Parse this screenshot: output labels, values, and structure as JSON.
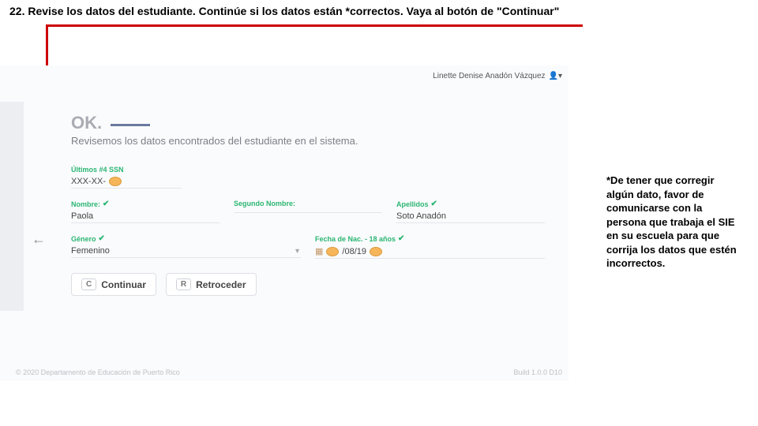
{
  "instruction": "22.  Revise los datos del estudiante.  Continúe si los datos están *correctos.  Vaya al botón de \"Continuar\"",
  "note": "*De tener que corregir algún dato, favor de comunicarse con la persona que trabaja el SIE en su escuela para que corrija los datos que estén incorrectos.",
  "user": {
    "name": "Linette Denise Anadón Vázquez"
  },
  "heading": {
    "ok": "OK.",
    "sub": "Revisemos los datos encontrados del estudiante en el sistema."
  },
  "fields": {
    "ssn": {
      "label": "Últimos #4 SSN",
      "value": "XXX-XX-"
    },
    "name": {
      "label": "Nombre:",
      "value": "Paola"
    },
    "second": {
      "label": "Segundo Nombre:",
      "value": ""
    },
    "last": {
      "label": "Apellidos",
      "value": "Soto Anadón"
    },
    "gender": {
      "label": "Género",
      "value": "Femenino"
    },
    "dob": {
      "label": "Fecha de Nac. - 18 años",
      "value": "/08/19"
    }
  },
  "buttons": {
    "continue": "Continuar",
    "back": "Retroceder",
    "kC": "C",
    "kR": "R"
  },
  "footer": {
    "left": "© 2020 Departamento de Educación de Puerto Rico",
    "right": "Build 1.0.0 D10"
  }
}
